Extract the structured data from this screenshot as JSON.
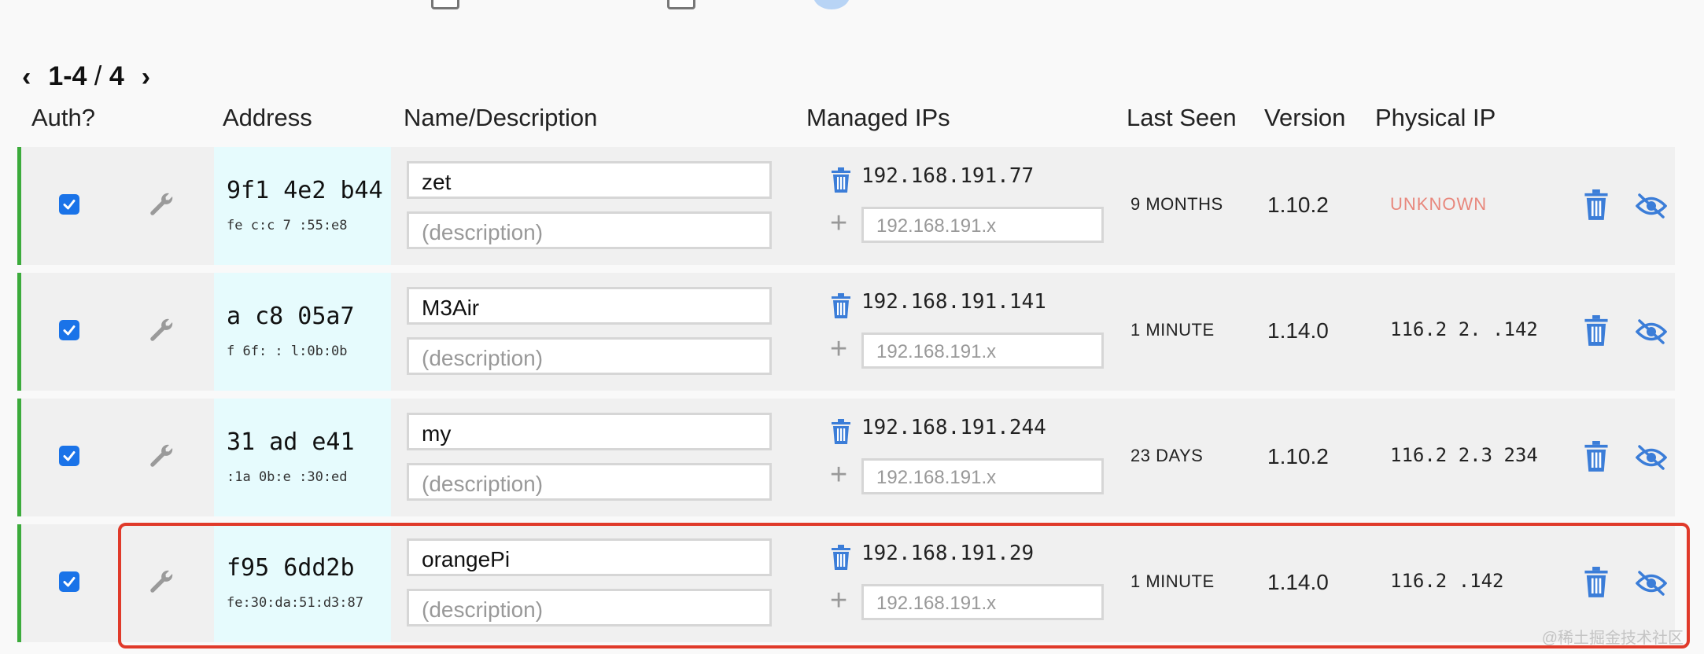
{
  "pager": {
    "range": "1-4",
    "separator": "/",
    "total": "4"
  },
  "columns": {
    "auth": "Auth?",
    "address": "Address",
    "name": "Name/Description",
    "managed": "Managed IPs",
    "last_seen": "Last Seen",
    "version": "Version",
    "physical": "Physical IP"
  },
  "rows": [
    {
      "authorized": true,
      "address": "9f1 4e2 b44",
      "mac": "fe c:c 7 :55:e8",
      "name": "zet",
      "description_placeholder": "(description)",
      "managed_ip": "192.168.191.77",
      "ip_placeholder": "192.168.191.x",
      "last_seen": "9 MONTHS",
      "version": "1.10.2",
      "physical_ip": "UNKNOWN"
    },
    {
      "authorized": true,
      "address": "a c8 05a7",
      "mac": "f 6f: : l:0b:0b",
      "name": "M3Air",
      "description_placeholder": "(description)",
      "managed_ip": "192.168.191.141",
      "ip_placeholder": "192.168.191.x",
      "last_seen": "1 MINUTE",
      "version": "1.14.0",
      "physical_ip": "116.2 2. .142"
    },
    {
      "authorized": true,
      "address": "31 ad e41",
      "mac": ":1a 0b:e :30:ed",
      "name": "my",
      "description_placeholder": "(description)",
      "managed_ip": "192.168.191.244",
      "ip_placeholder": "192.168.191.x",
      "last_seen": "23 DAYS",
      "version": "1.10.2",
      "physical_ip": "116.2 2.3 234"
    },
    {
      "authorized": true,
      "address": "f95 6dd2b",
      "mac": "fe:30:da:51:d3:87",
      "name": "orangePi",
      "description_placeholder": "(description)",
      "managed_ip": "192.168.191.29",
      "ip_placeholder": "192.168.191.x",
      "last_seen": "1 MINUTE",
      "version": "1.14.0",
      "physical_ip": "116.2 .142"
    }
  ],
  "watermark": "@稀土掘金技术社区",
  "colors": {
    "accent": "#1a73e8",
    "online_border": "#3cab3c",
    "highlight": "#e03a2a",
    "unknown": "#e8877c",
    "icon_blue": "#3b7dd8"
  }
}
